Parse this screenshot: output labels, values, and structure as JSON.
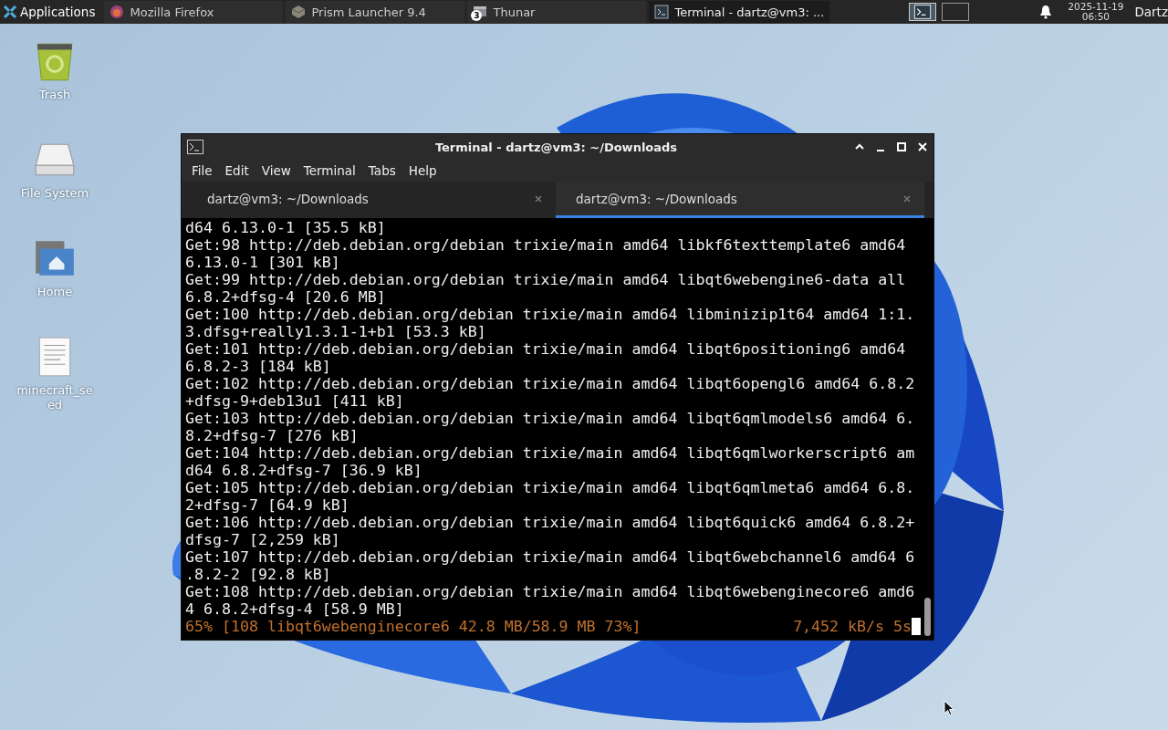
{
  "taskbar": {
    "menu_label": "Applications",
    "tasks": [
      {
        "label": "Mozilla Firefox",
        "kind": "browser",
        "selected": false
      },
      {
        "label": "Prism Launcher 9.4",
        "kind": "launcher",
        "selected": false
      },
      {
        "label": "Thunar",
        "kind": "files",
        "badge": "3",
        "selected": false
      },
      {
        "label": "Terminal - dartz@vm3: ...",
        "kind": "terminal",
        "selected": true
      }
    ],
    "workspaces": [
      {
        "selected": true
      },
      {
        "selected": false
      }
    ],
    "date": "2025-11-19",
    "time": "06:50",
    "user": "Dartz"
  },
  "desktop_icons": [
    {
      "label": "Trash",
      "kind": "trash"
    },
    {
      "label": "File System",
      "kind": "drive"
    },
    {
      "label": "Home",
      "kind": "home"
    },
    {
      "label": "minecraft_seed",
      "kind": "document"
    }
  ],
  "window": {
    "title": "Terminal - dartz@vm3: ~/Downloads",
    "menu": [
      "File",
      "Edit",
      "View",
      "Terminal",
      "Tabs",
      "Help"
    ],
    "tabs": [
      {
        "label": "dartz@vm3: ~/Downloads",
        "selected": false
      },
      {
        "label": "dartz@vm3: ~/Downloads",
        "selected": true
      }
    ],
    "lines": [
      {
        "kind": "output",
        "text": "d64 6.13.0-1 [35.5 kB]"
      },
      {
        "kind": "output",
        "text": "Get:98 http://deb.debian.org/debian trixie/main amd64 libkf6texttemplate6 amd64"
      },
      {
        "kind": "output",
        "text": "6.13.0-1 [301 kB]"
      },
      {
        "kind": "output",
        "text": "Get:99 http://deb.debian.org/debian trixie/main amd64 libqt6webengine6-data all"
      },
      {
        "kind": "output",
        "text": "6.8.2+dfsg-4 [20.6 MB]"
      },
      {
        "kind": "output",
        "text": "Get:100 http://deb.debian.org/debian trixie/main amd64 libminizip1t64 amd64 1:1."
      },
      {
        "kind": "output",
        "text": "3.dfsg+really1.3.1-1+b1 [53.3 kB]"
      },
      {
        "kind": "output",
        "text": "Get:101 http://deb.debian.org/debian trixie/main amd64 libqt6positioning6 amd64"
      },
      {
        "kind": "output",
        "text": "6.8.2-3 [184 kB]"
      },
      {
        "kind": "output",
        "text": "Get:102 http://deb.debian.org/debian trixie/main amd64 libqt6opengl6 amd64 6.8.2"
      },
      {
        "kind": "output",
        "text": "+dfsg-9+deb13u1 [411 kB]"
      },
      {
        "kind": "output",
        "text": "Get:103 http://deb.debian.org/debian trixie/main amd64 libqt6qmlmodels6 amd64 6."
      },
      {
        "kind": "output",
        "text": "8.2+dfsg-7 [276 kB]"
      },
      {
        "kind": "output",
        "text": "Get:104 http://deb.debian.org/debian trixie/main amd64 libqt6qmlworkerscript6 am"
      },
      {
        "kind": "output",
        "text": "d64 6.8.2+dfsg-7 [36.9 kB]"
      },
      {
        "kind": "output",
        "text": "Get:105 http://deb.debian.org/debian trixie/main amd64 libqt6qmlmeta6 amd64 6.8."
      },
      {
        "kind": "output",
        "text": "2+dfsg-7 [64.9 kB]"
      },
      {
        "kind": "output",
        "text": "Get:106 http://deb.debian.org/debian trixie/main amd64 libqt6quick6 amd64 6.8.2+"
      },
      {
        "kind": "output",
        "text": "dfsg-7 [2,259 kB]"
      },
      {
        "kind": "output",
        "text": "Get:107 http://deb.debian.org/debian trixie/main amd64 libqt6webchannel6 amd64 6"
      },
      {
        "kind": "output",
        "text": ".8.2-2 [92.8 kB]"
      },
      {
        "kind": "output",
        "text": "Get:108 http://deb.debian.org/debian trixie/main amd64 libqt6webenginecore6 amd6"
      },
      {
        "kind": "output",
        "text": "4 6.8.2+dfsg-4 [58.9 MB]"
      },
      {
        "kind": "progress",
        "text": "65% [108 libqt6webenginecore6 42.8 MB/58.9 MB 73%]",
        "rate": "7,452 kB/s 5s"
      }
    ]
  }
}
